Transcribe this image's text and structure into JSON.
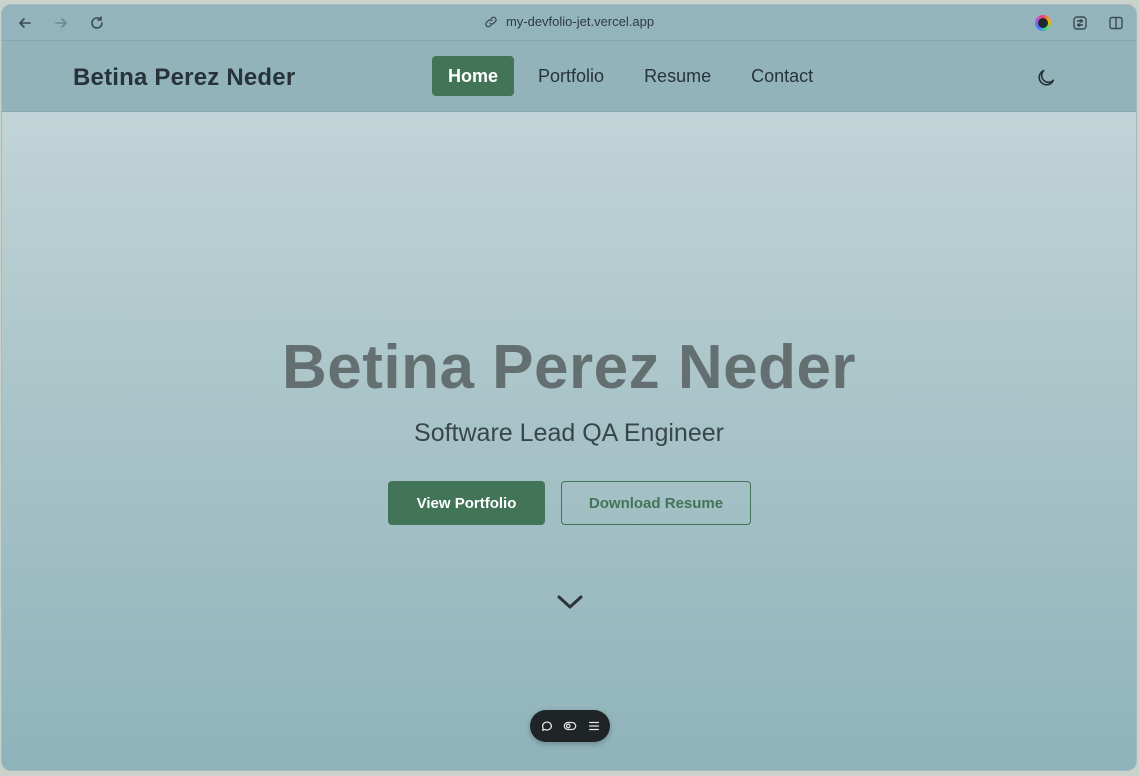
{
  "browser": {
    "url": "my-devfolio-jet.vercel.app"
  },
  "site": {
    "brand": "Betina Perez Neder",
    "nav": [
      {
        "label": "Home",
        "active": true
      },
      {
        "label": "Portfolio",
        "active": false
      },
      {
        "label": "Resume",
        "active": false
      },
      {
        "label": "Contact",
        "active": false
      }
    ]
  },
  "hero": {
    "title": "Betina Perez Neder",
    "subtitle": "Software Lead QA Engineer",
    "primary_button": "View Portfolio",
    "secondary_button": "Download Resume"
  },
  "colors": {
    "accent": "#427558",
    "header_bg": "#92b3ba",
    "text_dark": "#26343a"
  },
  "icons": {
    "back": "arrow-left-icon",
    "forward": "arrow-right-icon",
    "reload": "reload-icon",
    "link": "link-icon",
    "extension": "color-extension-icon",
    "settings": "sliders-icon",
    "sidebar": "sidebar-icon",
    "theme": "moon-icon",
    "scroll": "chevron-down-icon",
    "toolbar": [
      "comment-icon",
      "toggle-icon",
      "menu-icon"
    ]
  }
}
